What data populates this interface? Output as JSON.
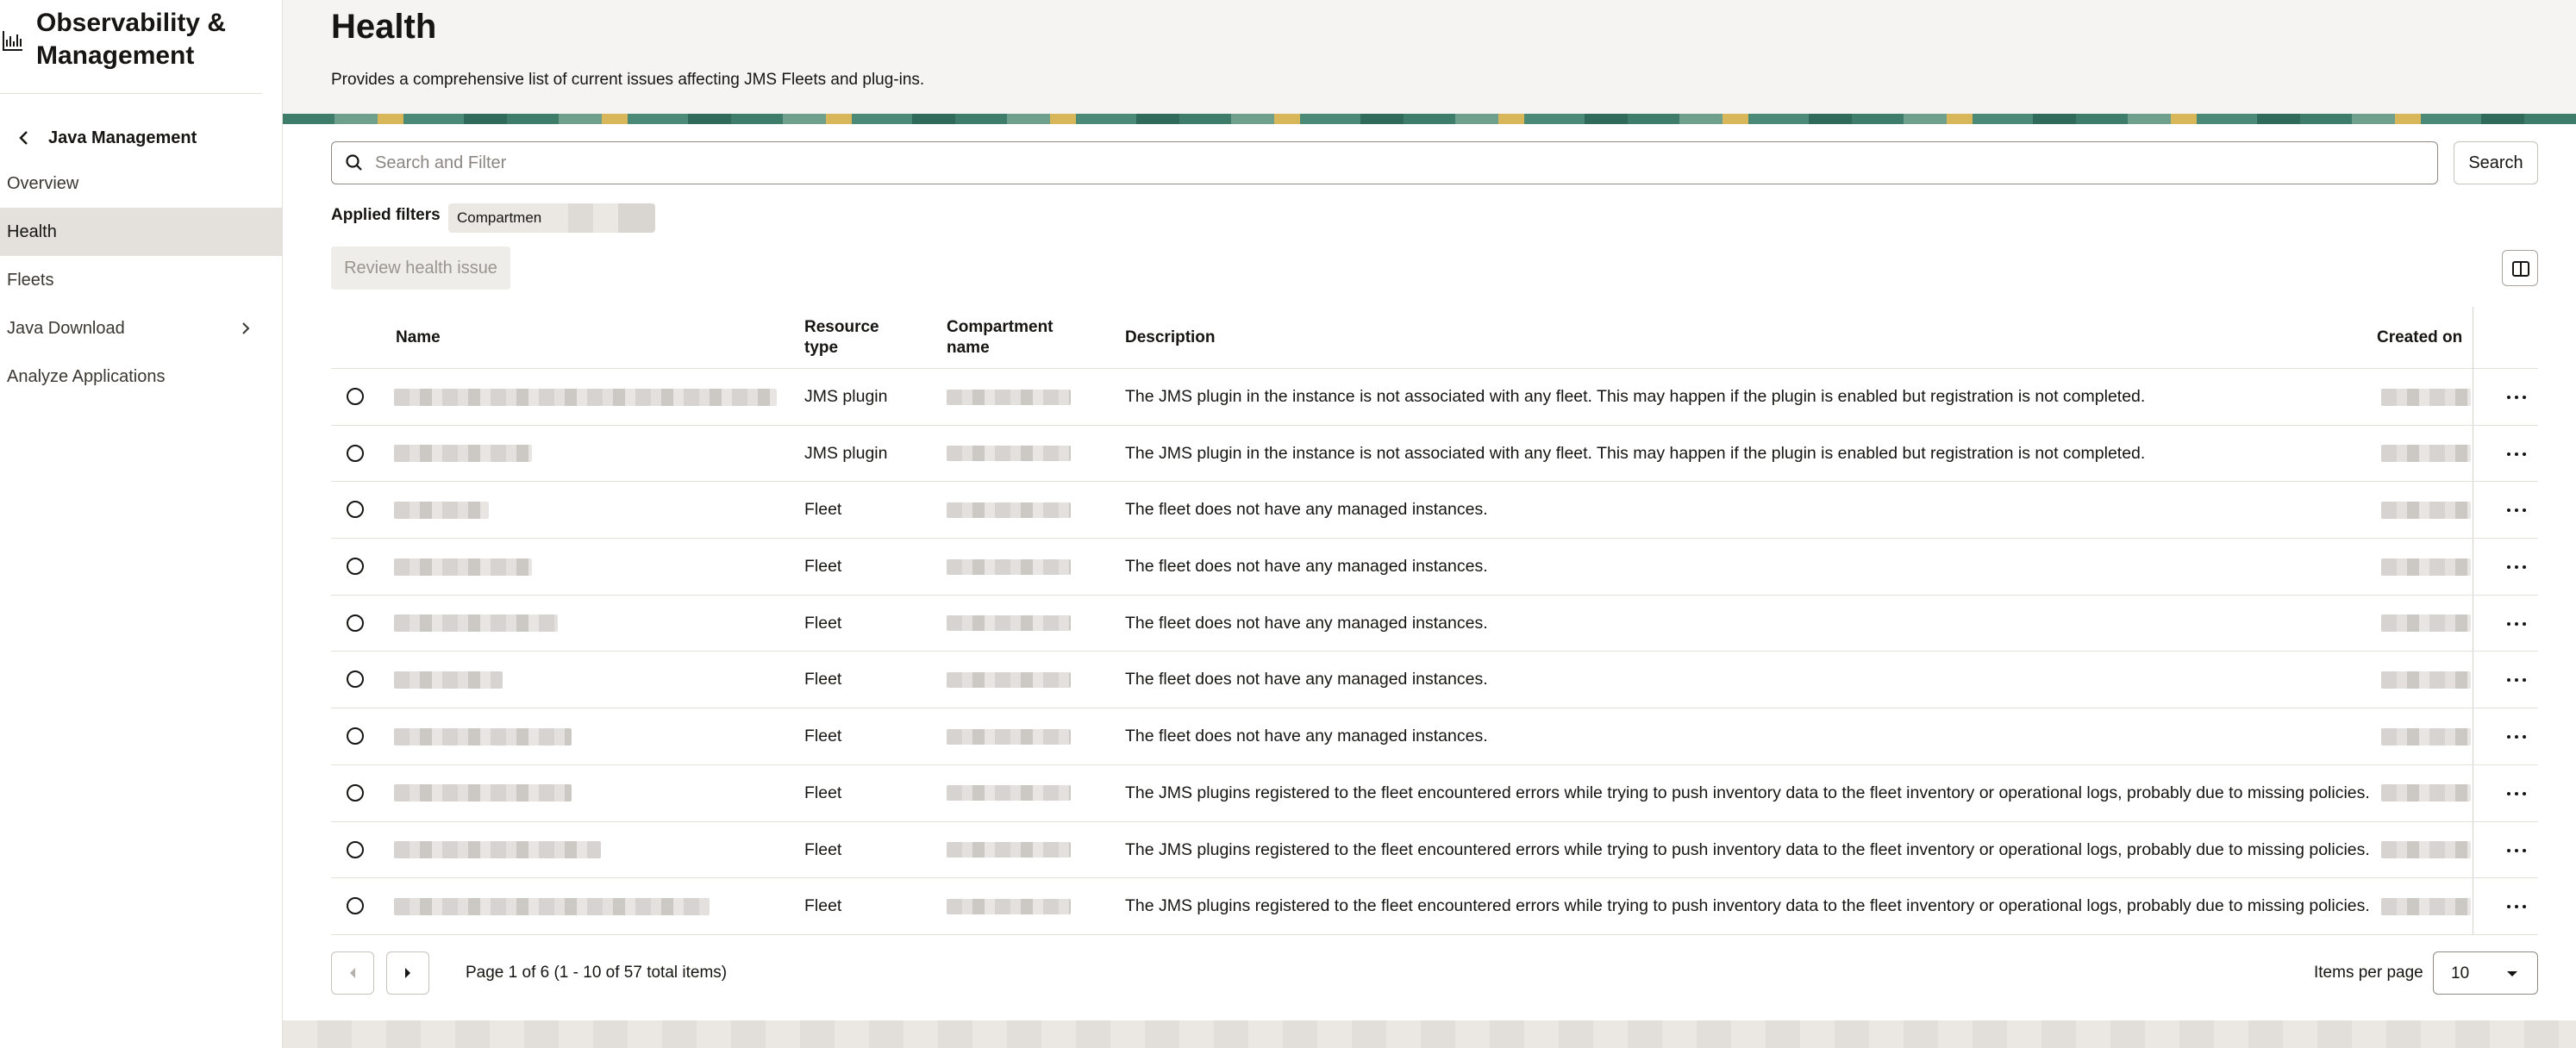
{
  "sidebar": {
    "brand_title": "Observability & Management",
    "back_label": "Java Management",
    "items": [
      {
        "label": "Overview"
      },
      {
        "label": "Health"
      },
      {
        "label": "Fleets"
      },
      {
        "label": "Java Download"
      },
      {
        "label": "Analyze Applications"
      }
    ],
    "active_item": "Health"
  },
  "header": {
    "title": "Health",
    "description": "Provides a comprehensive list of current issues affecting JMS Fleets and plug-ins."
  },
  "search": {
    "placeholder": "Search and Filter",
    "button_label": "Search"
  },
  "filters": {
    "label": "Applied filters",
    "chip_label": "Compartmen"
  },
  "toolbar": {
    "review_label": "Review health issue"
  },
  "table": {
    "columns": {
      "name": "Name",
      "resource_type": "Resource type",
      "compartment": "Compartment name",
      "description": "Description",
      "created_on": "Created on"
    },
    "rows": [
      {
        "type": "JMS plugin",
        "description": "The JMS plugin in the instance is not associated with any fleet. This may happen if the plugin is enabled but registration is not completed."
      },
      {
        "type": "JMS plugin",
        "description": "The JMS plugin in the instance is not associated with any fleet. This may happen if the plugin is enabled but registration is not completed."
      },
      {
        "type": "Fleet",
        "description": "The fleet does not have any managed instances."
      },
      {
        "type": "Fleet",
        "description": "The fleet does not have any managed instances."
      },
      {
        "type": "Fleet",
        "description": "The fleet does not have any managed instances."
      },
      {
        "type": "Fleet",
        "description": "The fleet does not have any managed instances."
      },
      {
        "type": "Fleet",
        "description": "The fleet does not have any managed instances."
      },
      {
        "type": "Fleet",
        "description": "The JMS plugins registered to the fleet encountered errors while trying to push inventory data to the fleet inventory or operational logs, probably due to missing policies."
      },
      {
        "type": "Fleet",
        "description": "The JMS plugins registered to the fleet encountered errors while trying to push inventory data to the fleet inventory or operational logs, probably due to missing policies."
      },
      {
        "type": "Fleet",
        "description": "The JMS plugins registered to the fleet encountered errors while trying to push inventory data to the fleet inventory or operational logs, probably due to missing policies."
      }
    ]
  },
  "pagination": {
    "info": "Page 1 of 6 (1 - 10 of 57 total items)",
    "items_per_page_label": "Items per page",
    "items_per_page_value": "10"
  },
  "icons": {
    "brand": "chart-icon",
    "back": "chevron-left-icon",
    "search": "search-icon",
    "columns": "columns-icon",
    "row_actions": "more-horizontal-icon",
    "prev": "caret-left-icon",
    "next": "caret-right-icon",
    "dropdown": "caret-down-icon"
  }
}
